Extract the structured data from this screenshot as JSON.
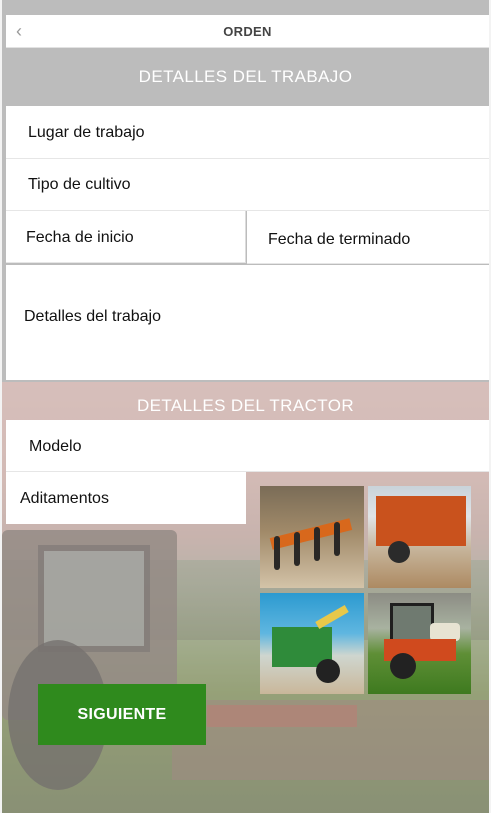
{
  "nav": {
    "title": "ORDEN",
    "back_icon": "chevron-left-icon"
  },
  "work_section": {
    "header": "DETALLES DEL TRABAJO",
    "fields": {
      "lugar": "Lugar de trabajo",
      "tipo": "Tipo de cultivo",
      "inicio": "Fecha de inicio",
      "fin": "Fecha de terminado",
      "detalles": "Detalles del trabajo"
    }
  },
  "tractor_section": {
    "header": "DETALLES DEL TRACTOR",
    "fields": {
      "modelo": "Modelo",
      "aditamentos": "Aditamentos"
    },
    "attachment_photos": [
      "cultivator-implement-photo",
      "trailer-implement-photo",
      "harvester-implement-photo",
      "sprayer-tractor-photo"
    ]
  },
  "actions": {
    "next_label": "SIGUIENTE"
  },
  "colors": {
    "accent": "#2f8a1d",
    "section_header_bg": "#bcbcbc",
    "field_bg": "#ffffff"
  }
}
